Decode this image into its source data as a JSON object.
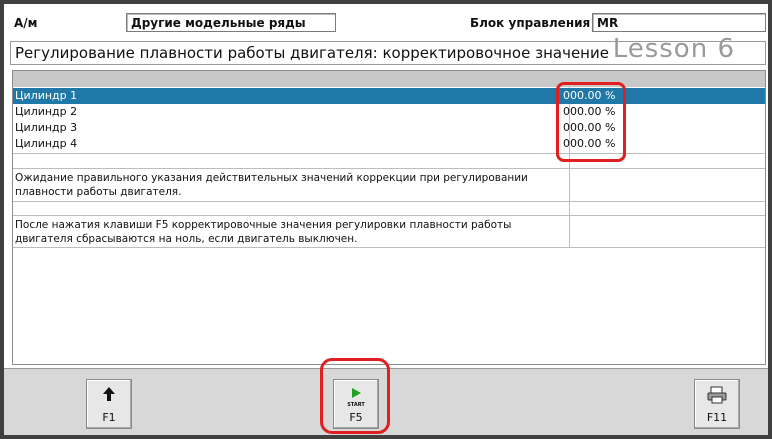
{
  "header": {
    "am_label": "A/м",
    "model_value": "Другие модельные ряды",
    "control_unit_label": "Блок управления",
    "control_unit_value": "MR"
  },
  "title": "Регулирование плавности работы двигателя: корректировочное значение",
  "watermark": "Lesson 6",
  "cylinders": [
    {
      "name": "Цилиндр 1",
      "value": "000.00  %"
    },
    {
      "name": "Цилиндр 2",
      "value": "000.00  %"
    },
    {
      "name": "Цилиндр 3",
      "value": "000.00  %"
    },
    {
      "name": "Цилиндр 4",
      "value": "000.00  %"
    }
  ],
  "notes": [
    "Ожидание правильного указания действительных значений коррекции при регулировании плавности работы двигателя.",
    "После нажатия клавиши F5 корректировочные значения регулировки плавности работы двигателя сбрасываются на ноль, если двигатель выключен."
  ],
  "toolbar": {
    "f1_label": "F1",
    "f5_label": "F5",
    "f5_icon_text": "START",
    "f11_label": "F11"
  },
  "colors": {
    "selection": "#1f78a8",
    "highlight_box": "#e02020",
    "start_arrow": "#22a022"
  },
  "icons": [
    "up-arrow-icon",
    "start-play-icon",
    "printer-icon"
  ]
}
